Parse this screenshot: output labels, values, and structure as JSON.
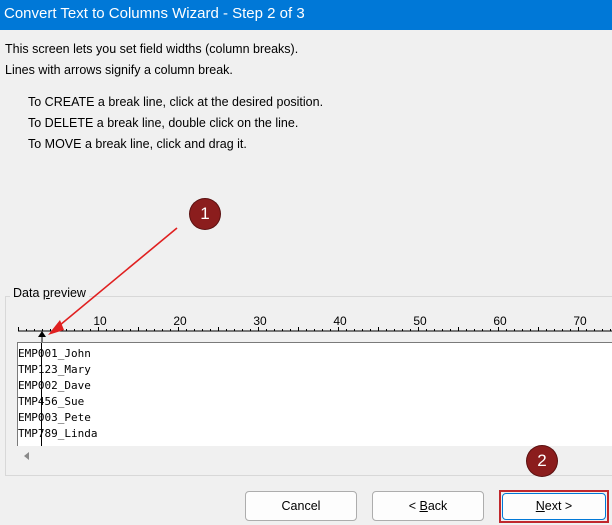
{
  "window": {
    "title": "Convert Text to Columns Wizard - Step 2 of 3"
  },
  "description": {
    "line1": "This screen lets you set field widths (column breaks).",
    "line2": "Lines with arrows signify a column break."
  },
  "instructions": [
    "To CREATE a break line, click at the desired position.",
    "To DELETE a break line, double click on the line.",
    "To MOVE a break line, click and drag it."
  ],
  "preview": {
    "label_pre": "Data ",
    "label_ul": "p",
    "label_post": "review",
    "ruler_ticks": [
      "10",
      "20",
      "30",
      "40",
      "50",
      "60",
      "70"
    ],
    "rows": [
      "EMP001_John",
      "TMP123_Mary",
      "EMP002_Dave",
      "TMP456_Sue",
      "EMP003_Pete",
      "TMP789_Linda"
    ]
  },
  "annotations": {
    "badge1": "1",
    "badge2": "2",
    "color": "#8b1d1d",
    "arrow_color": "#e02020"
  },
  "buttons": {
    "cancel": "Cancel",
    "back_pre": "< ",
    "back_ul": "B",
    "back_post": "ack",
    "next_ul": "N",
    "next_post": "ext >"
  }
}
